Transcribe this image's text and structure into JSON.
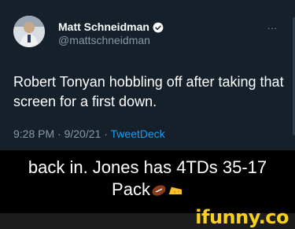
{
  "tweet": {
    "author_name": "Matt Schneidman",
    "handle": "@mattschneidman",
    "more_label": "...",
    "text": "Robert Tonyan hobbling off after taking that screen for a first down.",
    "time": "9:28 PM",
    "date": "9/20/21",
    "separator": "·",
    "source": "TweetDeck"
  },
  "caption": {
    "line1": "back in. Jones has 4TDs 35-17",
    "line2": "Pack"
  },
  "watermark": {
    "logo_text": "ifunny.co"
  },
  "colors": {
    "tweet_bg": "#15202b",
    "secondary_text": "#8899a6",
    "link": "#1d9bf0",
    "watermark": "#f7d11e"
  }
}
